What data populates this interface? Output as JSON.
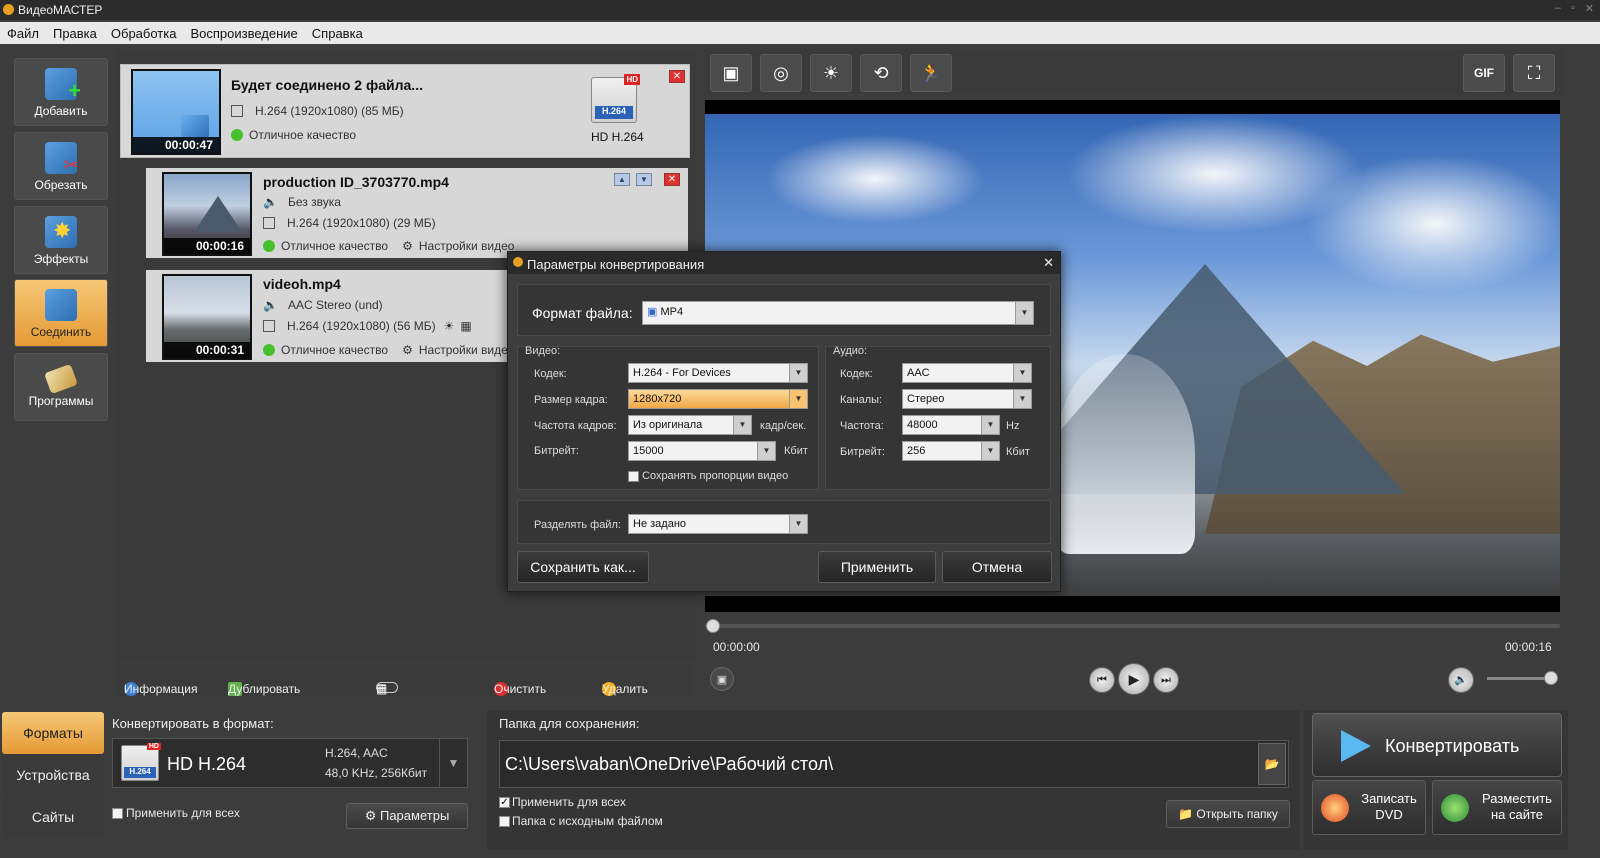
{
  "app": {
    "title": "ВидеоМАСТЕР"
  },
  "menu": [
    "Файл",
    "Правка",
    "Обработка",
    "Воспроизведение",
    "Справка"
  ],
  "sidebar": [
    {
      "label": "Добавить",
      "icon": "add-video-icon"
    },
    {
      "label": "Обрезать",
      "icon": "scissors-icon"
    },
    {
      "label": "Эффекты",
      "icon": "effects-icon"
    },
    {
      "label": "Соединить",
      "icon": "join-icon"
    },
    {
      "label": "Программы",
      "icon": "programs-icon"
    }
  ],
  "merge_card": {
    "title": "Будет соединено 2 файла...",
    "spec": "H.264 (1920x1080) (85 МБ)",
    "quality": "Отличное качество",
    "duration": "00:00:47",
    "format_badge": "HD H.264",
    "badge_top": "HD",
    "badge_codec": "H.264"
  },
  "files": [
    {
      "name": "production ID_3703770.mp4",
      "audio": "Без звука",
      "spec": "H.264 (1920x1080) (29 МБ)",
      "quality": "Отличное качество",
      "settings": "Настройки видео",
      "duration": "00:00:16"
    },
    {
      "name": "videoh.mp4",
      "audio": "AAC Stereo (und)",
      "spec": "H.264 (1920x1080) (56 МБ)",
      "quality": "Отличное качество",
      "settings": "Настройки видео",
      "duration": "00:00:31"
    }
  ],
  "file_toolbar": {
    "info": "Информация",
    "duplicate": "Дублировать",
    "clear": "Очистить",
    "delete": "Удалить"
  },
  "preview_toolbar": {
    "gif": "GIF"
  },
  "player": {
    "time_current": "00:00:00",
    "time_total": "00:00:16",
    "progress": 0,
    "volume": 1.0
  },
  "format_tabs": [
    "Форматы",
    "Устройства",
    "Сайты"
  ],
  "convert_to": {
    "label": "Конвертировать в формат:",
    "format": "HD H.264",
    "details1": "H.264, AAC",
    "details2": "48,0 KHz, 256Кбит",
    "apply_all": "Применить для всех",
    "params": "Параметры"
  },
  "save_folder": {
    "label": "Папка для сохранения:",
    "path": "C:\\Users\\vaban\\OneDrive\\Рабочий стол\\",
    "apply_all": "Применить для всех",
    "source_folder": "Папка с исходным файлом",
    "open_folder": "Открыть папку"
  },
  "actions": {
    "convert": "Конвертировать",
    "burn_dvd_1": "Записать",
    "burn_dvd_2": "DVD",
    "publish_1": "Разместить",
    "publish_2": "на сайте"
  },
  "dialog": {
    "title": "Параметры конвертирования",
    "file_format_label": "Формат файла:",
    "file_format": "MP4",
    "video_label": "Видео:",
    "audio_label": "Аудио:",
    "codec_label": "Кодек:",
    "video_codec": "H.264 - For Devices",
    "frame_size_label": "Размер кадра:",
    "frame_size": "1280x720",
    "fps_label": "Частота кадров:",
    "fps": "Из оригинала",
    "fps_unit": "кадр/сек.",
    "bitrate_label": "Битрейт:",
    "video_bitrate": "15000",
    "bitrate_unit": "Кбит",
    "keep_aspect": "Сохранять пропорции видео",
    "audio_codec": "AAC",
    "channels_label": "Каналы:",
    "channels": "Стерео",
    "freq_label": "Частота:",
    "freq": "48000",
    "freq_unit": "Hz",
    "audio_bitrate": "256",
    "split_label": "Разделять файл:",
    "split": "Не задано",
    "save_as": "Сохранить как...",
    "apply": "Применить",
    "cancel": "Отмена"
  }
}
